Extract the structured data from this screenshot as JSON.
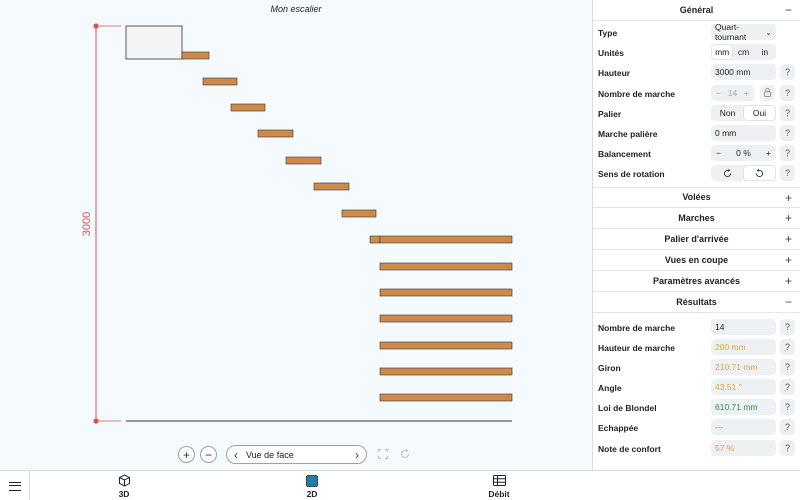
{
  "canvas": {
    "project_title": "Mon escalier",
    "dimension_label": "3000",
    "view_select": {
      "prev_icon": "chevron-left",
      "label": "Vue de face",
      "next_icon": "chevron-right"
    },
    "zoom_in": "+",
    "zoom_out": "−",
    "colors": {
      "tread": "#cd8a4a",
      "dimension": "#e2504c",
      "ground": "#333333"
    }
  },
  "nav": {
    "tabs": [
      {
        "label": "3D",
        "icon": "cube-icon"
      },
      {
        "label": "2D",
        "icon": "square-icon"
      },
      {
        "label": "Débit",
        "icon": "table-icon"
      }
    ],
    "accent": "#1f7fa8"
  },
  "panel": {
    "general": {
      "title": "Général",
      "collapse_symbol": "−",
      "type": {
        "label": "Type",
        "value": "Quart-tournant"
      },
      "units": {
        "label": "Unités",
        "options": [
          "mm",
          "cm",
          "in"
        ],
        "selected": "mm"
      },
      "height": {
        "label": "Hauteur",
        "value": "3000 mm"
      },
      "step_count": {
        "label": "Nombre de marche",
        "value": "14",
        "minus": "−",
        "plus": "+"
      },
      "landing": {
        "label": "Palier",
        "options": [
          "Non",
          "Oui"
        ],
        "selected": "Oui"
      },
      "landing_step": {
        "label": "Marche palière",
        "value": "0 mm"
      },
      "balancing": {
        "label": "Balancement",
        "value": "0 %",
        "minus": "−",
        "plus": "+"
      },
      "rotation": {
        "label": "Sens de rotation",
        "selected": "counterclockwise"
      }
    },
    "sections": [
      {
        "title": "Volées",
        "symbol": "+"
      },
      {
        "title": "Marches",
        "symbol": "+"
      },
      {
        "title": "Palier d'arrivée",
        "symbol": "+"
      },
      {
        "title": "Vues en coupe",
        "symbol": "+"
      },
      {
        "title": "Paramètres avancés",
        "symbol": "+"
      }
    ],
    "results": {
      "title": "Résultats",
      "collapse_symbol": "−",
      "rows": [
        {
          "label": "Nombre de marche",
          "value": "14",
          "tone": "normal"
        },
        {
          "label": "Hauteur de marche",
          "value": "200 mm",
          "tone": "orange"
        },
        {
          "label": "Giron",
          "value": "210.71 mm",
          "tone": "orange"
        },
        {
          "label": "Angle",
          "value": "43.51 °",
          "tone": "orange"
        },
        {
          "label": "Loi de Blondel",
          "value": "610.71 mm",
          "tone": "green"
        },
        {
          "label": "Echappée",
          "value": "---",
          "tone": "grey"
        },
        {
          "label": "Note de confort",
          "value": "57 %",
          "tone": "orange"
        }
      ]
    },
    "help_symbol": "?"
  }
}
